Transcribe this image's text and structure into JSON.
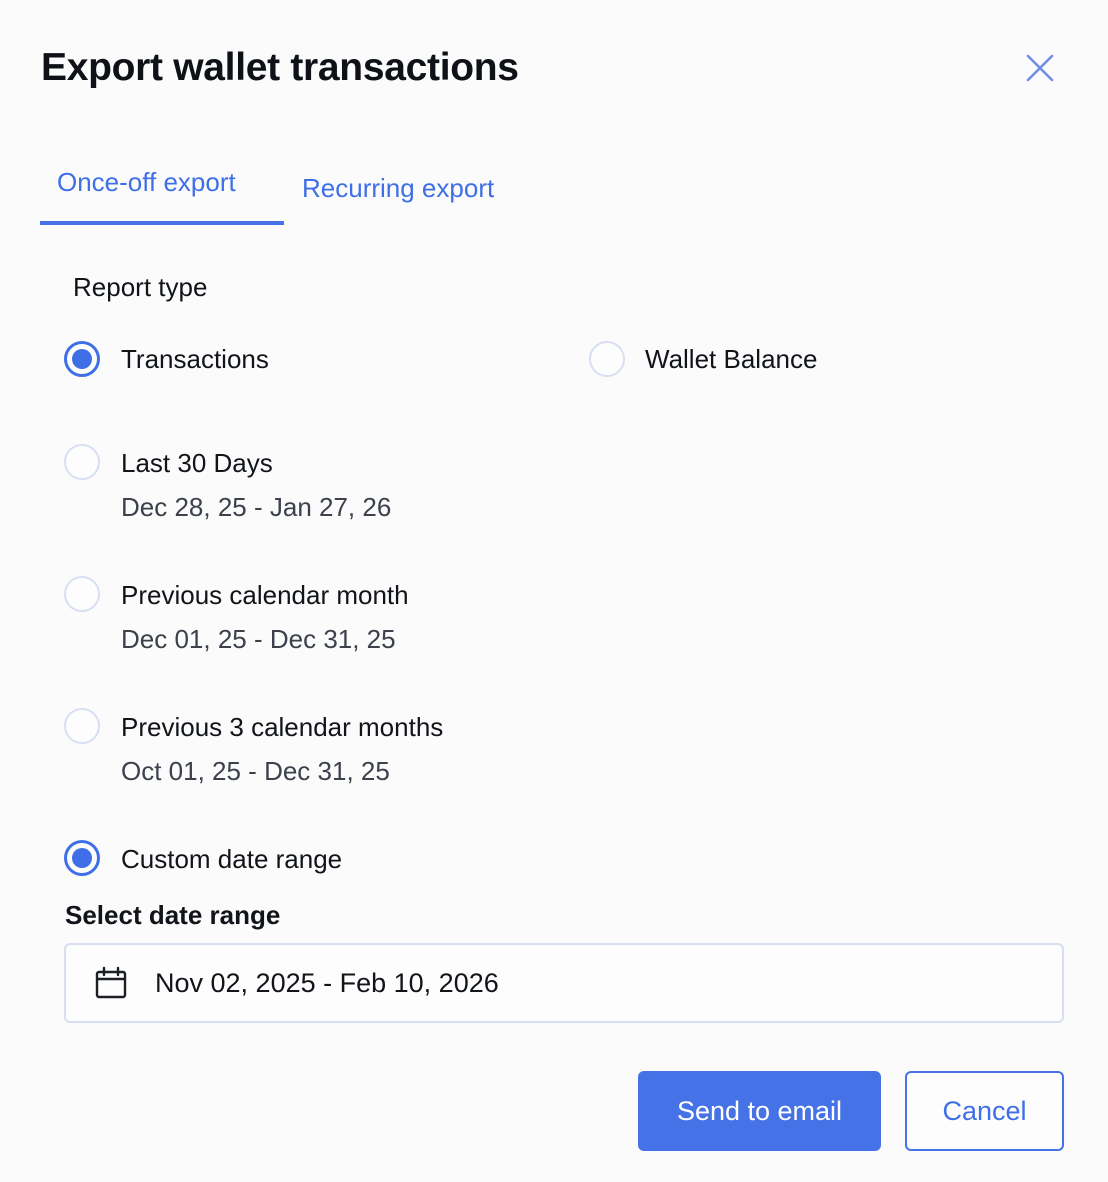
{
  "dialog": {
    "title": "Export wallet transactions",
    "close_icon": "close-icon"
  },
  "tabs": [
    {
      "label": "Once-off export",
      "active": true
    },
    {
      "label": "Recurring export",
      "active": false
    }
  ],
  "report_type": {
    "label": "Report type",
    "options": [
      {
        "label": "Transactions",
        "selected": true
      },
      {
        "label": "Wallet Balance",
        "selected": false
      }
    ]
  },
  "date_options": [
    {
      "label": "Last 30 Days",
      "range": "Dec 28, 25 - Jan 27, 26",
      "selected": false
    },
    {
      "label": "Previous calendar month",
      "range": "Dec 01, 25 - Dec 31, 25",
      "selected": false
    },
    {
      "label": "Previous 3 calendar months",
      "range": "Oct 01, 25 - Dec 31, 25",
      "selected": false
    },
    {
      "label": "Custom date range",
      "selected": true
    }
  ],
  "custom_range": {
    "label": "Select date range",
    "value": "Nov 02, 2025 - Feb 10, 2026",
    "icon": "calendar-icon"
  },
  "actions": {
    "send_label": "Send to email",
    "cancel_label": "Cancel"
  },
  "colors": {
    "accent": "#4672e7",
    "radio_border": "#d7dff0",
    "text": "#111418"
  }
}
